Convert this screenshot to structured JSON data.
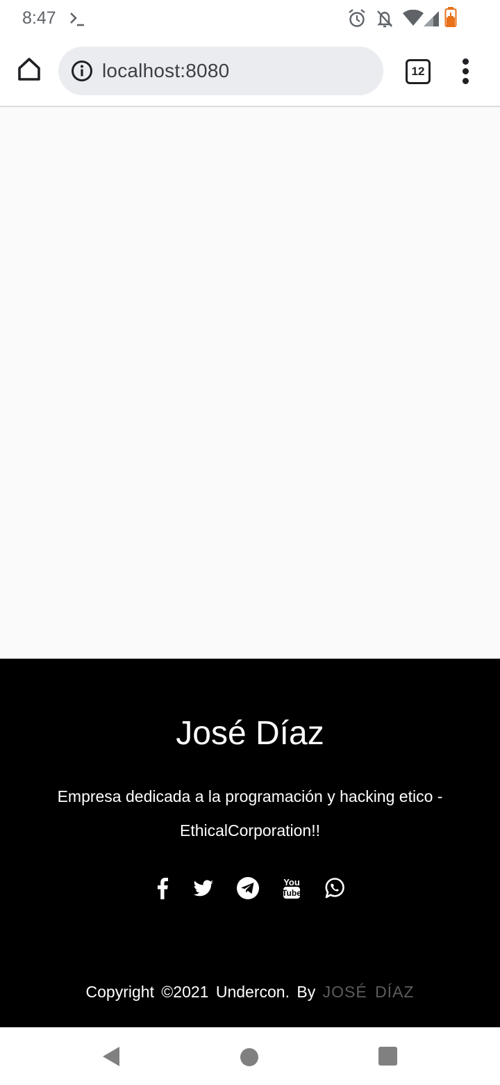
{
  "status_bar": {
    "time": "8:47",
    "icons": [
      "terminal-icon",
      "alarm-icon",
      "notifications-off-icon",
      "wifi-icon",
      "cellular-signal-icon",
      "battery-charging-icon"
    ],
    "battery_color": "#e8711a"
  },
  "browser": {
    "url": "localhost:8080",
    "tab_count": "12",
    "icons": [
      "home-icon",
      "info-icon",
      "more-vert-icon"
    ]
  },
  "footer": {
    "title": "José Díaz",
    "description": "Empresa dedicada a la programación y hacking etico - EthicalCorporation!!",
    "social": [
      {
        "name": "facebook-icon"
      },
      {
        "name": "twitter-icon"
      },
      {
        "name": "telegram-icon"
      },
      {
        "name": "youtube-icon",
        "text_top": "You",
        "text_bottom": "Tube"
      },
      {
        "name": "whatsapp-icon"
      }
    ],
    "copyright_prefix": "Copyright ©2021 Undercon. By",
    "copyright_author": "JOSÉ DÍAZ",
    "background": "#000000",
    "author_color": "#5c5c5c"
  },
  "page": {
    "background": "#fafafa"
  },
  "nav_bar": {
    "icons": [
      "back-icon",
      "home-circle-icon",
      "recents-icon"
    ]
  }
}
